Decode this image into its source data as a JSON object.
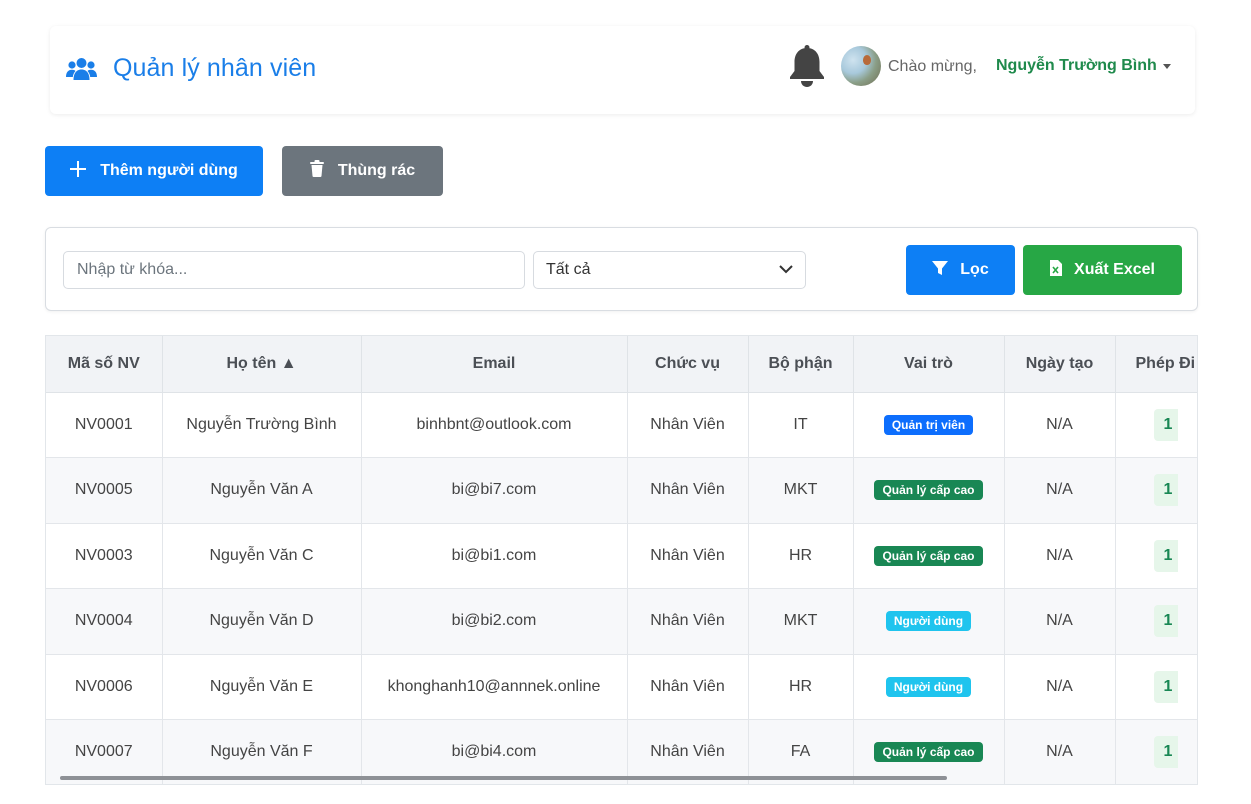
{
  "header": {
    "title": "Quản lý nhân viên",
    "welcome": "Chào mừng,",
    "user_name": "Nguyễn Trường Bình"
  },
  "actions": {
    "add_user": "Thêm người dùng",
    "trash": "Thùng rác"
  },
  "filters": {
    "search_placeholder": "Nhập từ khóa...",
    "role_select": "Tất cả",
    "filter_button": "Lọc",
    "export_button": "Xuất Excel"
  },
  "table": {
    "columns": [
      "Mã số NV",
      "Họ tên ▲",
      "Email",
      "Chức vụ",
      "Bộ phận",
      "Vai trò",
      "Ngày tạo",
      "Phép Đi"
    ],
    "rows": [
      {
        "id": "NV0001",
        "name": "Nguyễn Trường Bình",
        "email": "binhbnt@outlook.com",
        "position": "Nhân Viên",
        "dept": "IT",
        "role": "Quản trị viên",
        "role_type": "admin",
        "created": "N/A",
        "leave": "1"
      },
      {
        "id": "NV0005",
        "name": "Nguyễn Văn A",
        "email": "bi@bi7.com",
        "position": "Nhân Viên",
        "dept": "MKT",
        "role": "Quản lý cấp cao",
        "role_type": "senior",
        "created": "N/A",
        "leave": "1"
      },
      {
        "id": "NV0003",
        "name": "Nguyễn Văn C",
        "email": "bi@bi1.com",
        "position": "Nhân Viên",
        "dept": "HR",
        "role": "Quản lý cấp cao",
        "role_type": "senior",
        "created": "N/A",
        "leave": "1"
      },
      {
        "id": "NV0004",
        "name": "Nguyễn Văn D",
        "email": "bi@bi2.com",
        "position": "Nhân Viên",
        "dept": "MKT",
        "role": "Người dùng",
        "role_type": "user",
        "created": "N/A",
        "leave": "1"
      },
      {
        "id": "NV0006",
        "name": "Nguyễn Văn E",
        "email": "khonghanh10@annnek.online",
        "position": "Nhân Viên",
        "dept": "HR",
        "role": "Người dùng",
        "role_type": "user",
        "created": "N/A",
        "leave": "1"
      },
      {
        "id": "NV0007",
        "name": "Nguyễn Văn F",
        "email": "bi@bi4.com",
        "position": "Nhân Viên",
        "dept": "FA",
        "role": "Quản lý cấp cao",
        "role_type": "senior",
        "created": "N/A",
        "leave": "1"
      }
    ]
  },
  "colors": {
    "primary": "#0d7ff5",
    "brand_text": "#1a7ee8",
    "success": "#27a745",
    "secondary": "#6c757d",
    "user_name": "#1f8a4c",
    "badge_admin": "#0d6efd",
    "badge_senior": "#198754",
    "badge_user": "#1fc4ee"
  }
}
